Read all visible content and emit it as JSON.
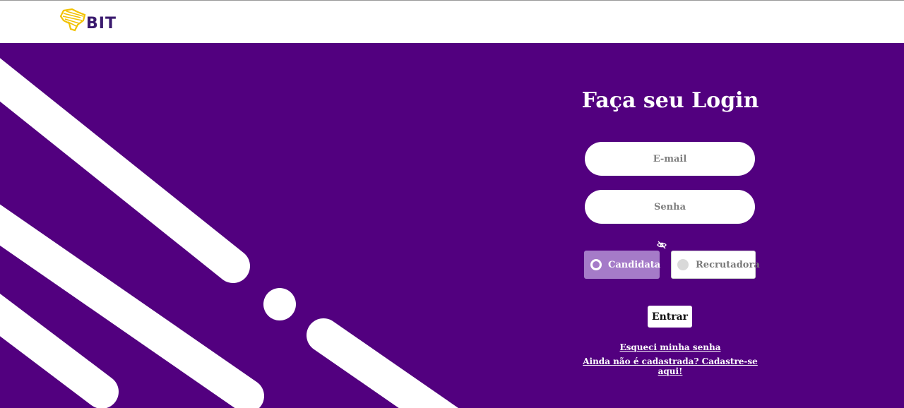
{
  "brand": {
    "logo_text": "BIT",
    "logo_color": "#f2c200",
    "text_color": "#3a1a6e"
  },
  "hero": {
    "background": "#52007f",
    "shape_color": "#ffffff"
  },
  "login": {
    "title": "Faça seu Login",
    "email_placeholder": "E-mail",
    "password_placeholder": "Senha",
    "show_password_icon": "eye-slash-icon",
    "roles": [
      {
        "label": "Candidata",
        "selected": true
      },
      {
        "label": "Recrutadora",
        "selected": false
      }
    ],
    "submit_label": "Entrar",
    "forgot_link": "Esqueci minha senha",
    "signup_link": "Ainda não é cadastrada? Cadastre-se aqui!"
  }
}
